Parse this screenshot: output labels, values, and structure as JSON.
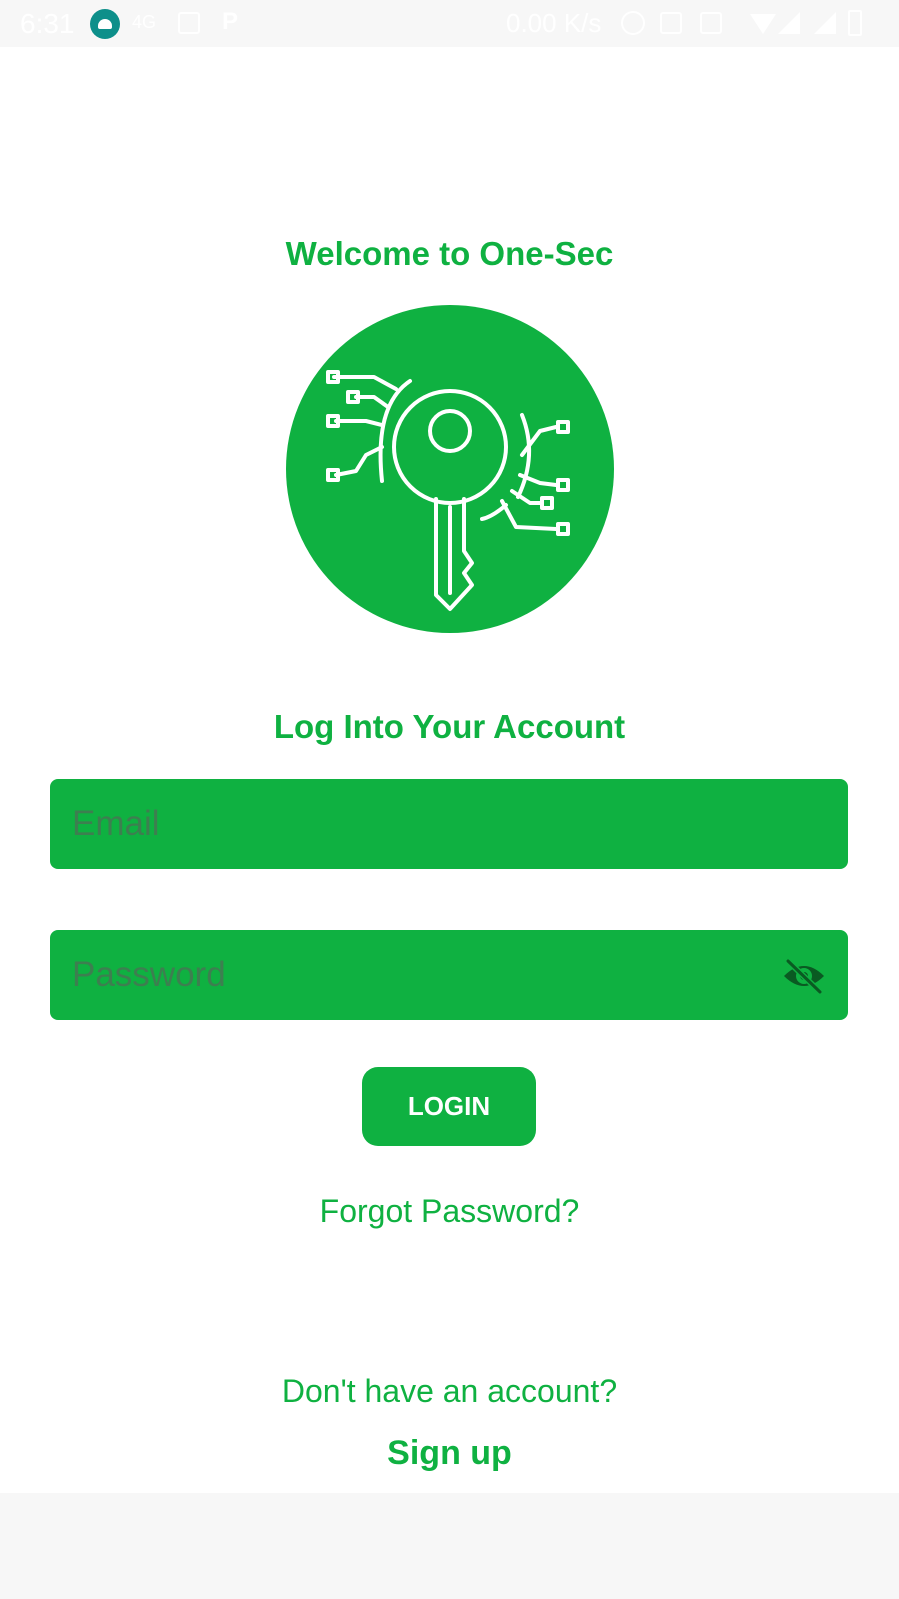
{
  "status_bar": {
    "time": "6:31",
    "network_type": "4G",
    "speed": "0.00 K/s",
    "icons": [
      "android-icon",
      "image-icon",
      "p-icon",
      "alarm-icon",
      "nfc-icon",
      "vibrate-icon",
      "wifi-icon",
      "signal-icon",
      "battery-icon"
    ]
  },
  "welcome": {
    "title": "Welcome to One-Sec"
  },
  "logo": {
    "icon": "circuit-key-icon",
    "color": "#0fb141"
  },
  "login": {
    "title": "Log Into Your Account",
    "email_placeholder": "Email",
    "email_value": "",
    "password_placeholder": "Password",
    "password_value": "",
    "password_toggle_icon": "eye-off-icon",
    "button_label": "LOGIN",
    "forgot_password": "Forgot Password?"
  },
  "signup": {
    "prompt": "Don't have an account?",
    "link": "Sign up"
  },
  "colors": {
    "accent": "#0fb141",
    "placeholder": "#3d7f50",
    "icon_dark": "#0a5a22"
  }
}
